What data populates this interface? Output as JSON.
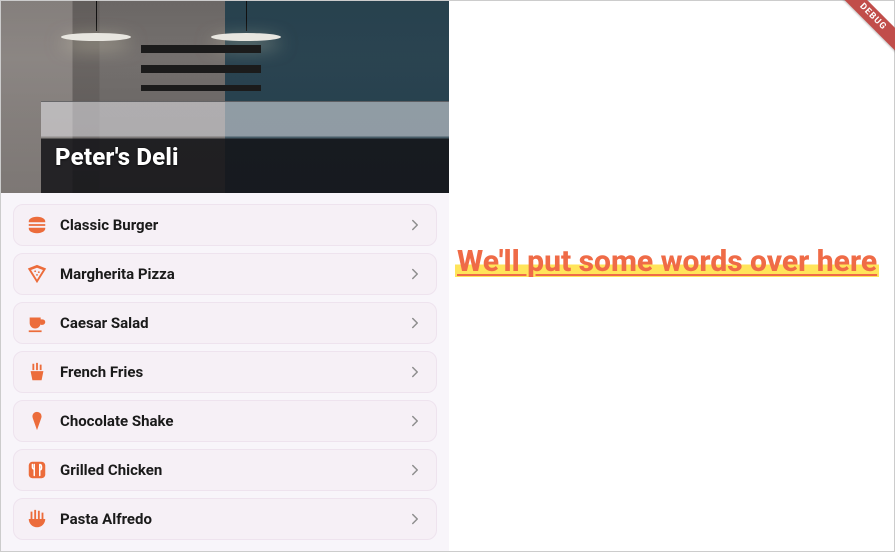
{
  "header": {
    "title": "Peter's Deli"
  },
  "menu": {
    "items": [
      {
        "icon": "burger-icon",
        "label": "Classic Burger"
      },
      {
        "icon": "pizza-icon",
        "label": "Margherita Pizza"
      },
      {
        "icon": "cup-icon",
        "label": "Caesar Salad"
      },
      {
        "icon": "fries-icon",
        "label": "French Fries"
      },
      {
        "icon": "icecream-icon",
        "label": "Chocolate Shake"
      },
      {
        "icon": "utensils-icon",
        "label": "Grilled Chicken"
      },
      {
        "icon": "noodles-icon",
        "label": "Pasta Alfredo"
      }
    ]
  },
  "right": {
    "heading": "We'll put some words over here"
  },
  "debug": {
    "label": "DEBUG"
  },
  "colors": {
    "accent": "#ec6c3b",
    "highlight": "#ffe45a",
    "headingText": "#ef6b47"
  }
}
